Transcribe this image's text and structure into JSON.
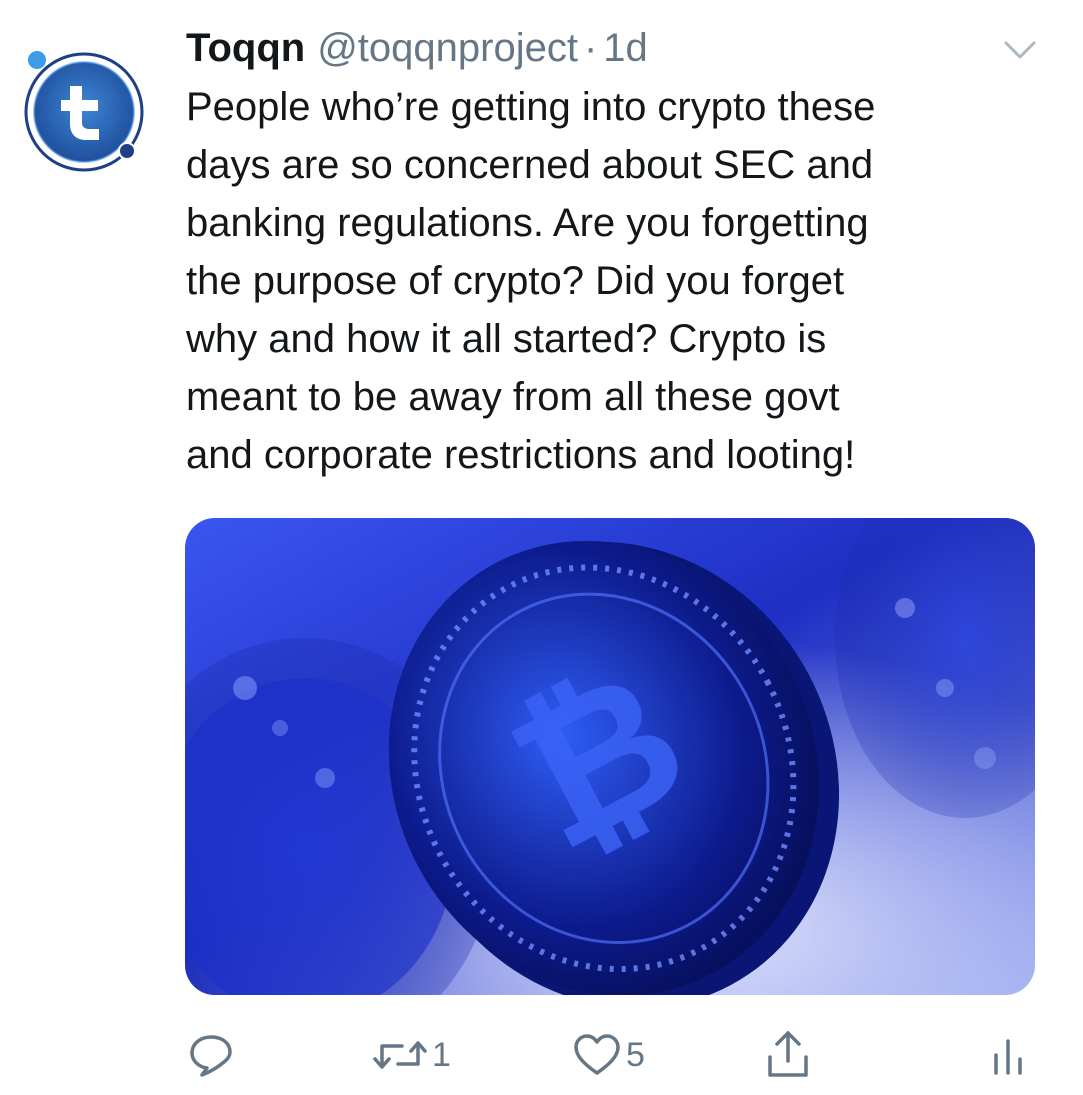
{
  "tweet": {
    "display_name": "Toqqn",
    "handle": "@toqqnproject",
    "separator": "·",
    "time": "1d",
    "text": "People who’re getting into crypto these\ndays are so concerned about SEC and\nbanking regulations. Are you forgetting\nthe purpose of crypto? Did you forget\nwhy and how it all started? Crypto is\nmeant to be away from all these govt\nand corporate restrictions and looting!"
  },
  "actions": {
    "reply_count": "",
    "retweet_count": "1",
    "like_count": "5"
  },
  "icons": {
    "avatar": "toqqn-logo-icon",
    "caret": "chevron-down-icon",
    "reply": "reply-icon",
    "retweet": "retweet-icon",
    "like": "heart-icon",
    "share": "share-icon",
    "analytics": "analytics-icon"
  },
  "colors": {
    "text": "#14171a",
    "secondary": "#657786",
    "logo_blue": "#2d6fbf",
    "logo_dark": "#1c3f86",
    "media_blue": "#2c3fd6"
  }
}
